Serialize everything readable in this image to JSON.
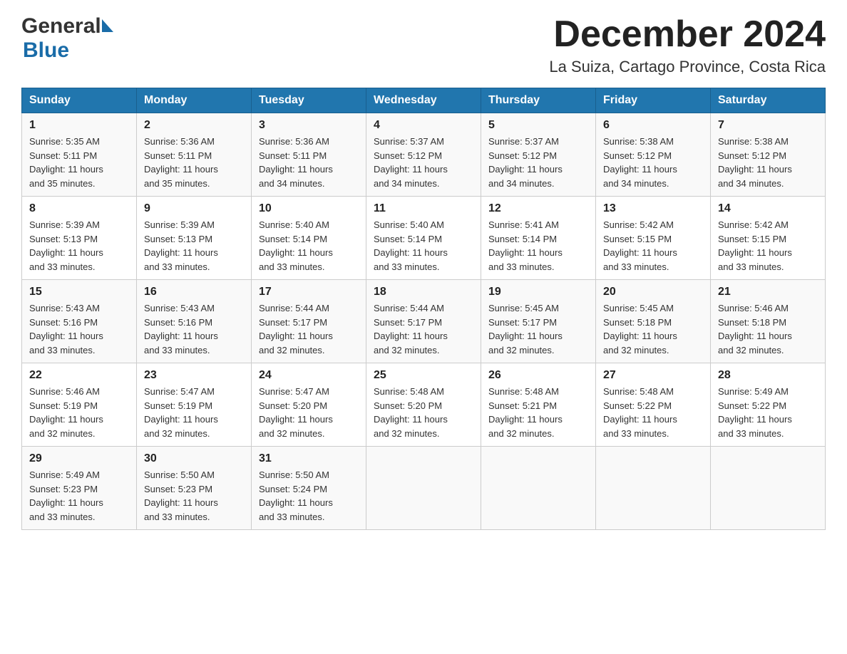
{
  "header": {
    "month_title": "December 2024",
    "location": "La Suiza, Cartago Province, Costa Rica"
  },
  "logo": {
    "general": "General",
    "blue": "Blue"
  },
  "days_of_week": [
    "Sunday",
    "Monday",
    "Tuesday",
    "Wednesday",
    "Thursday",
    "Friday",
    "Saturday"
  ],
  "weeks": [
    [
      {
        "day": "1",
        "sunrise": "5:35 AM",
        "sunset": "5:11 PM",
        "daylight": "11 hours and 35 minutes."
      },
      {
        "day": "2",
        "sunrise": "5:36 AM",
        "sunset": "5:11 PM",
        "daylight": "11 hours and 35 minutes."
      },
      {
        "day": "3",
        "sunrise": "5:36 AM",
        "sunset": "5:11 PM",
        "daylight": "11 hours and 34 minutes."
      },
      {
        "day": "4",
        "sunrise": "5:37 AM",
        "sunset": "5:12 PM",
        "daylight": "11 hours and 34 minutes."
      },
      {
        "day": "5",
        "sunrise": "5:37 AM",
        "sunset": "5:12 PM",
        "daylight": "11 hours and 34 minutes."
      },
      {
        "day": "6",
        "sunrise": "5:38 AM",
        "sunset": "5:12 PM",
        "daylight": "11 hours and 34 minutes."
      },
      {
        "day": "7",
        "sunrise": "5:38 AM",
        "sunset": "5:12 PM",
        "daylight": "11 hours and 34 minutes."
      }
    ],
    [
      {
        "day": "8",
        "sunrise": "5:39 AM",
        "sunset": "5:13 PM",
        "daylight": "11 hours and 33 minutes."
      },
      {
        "day": "9",
        "sunrise": "5:39 AM",
        "sunset": "5:13 PM",
        "daylight": "11 hours and 33 minutes."
      },
      {
        "day": "10",
        "sunrise": "5:40 AM",
        "sunset": "5:14 PM",
        "daylight": "11 hours and 33 minutes."
      },
      {
        "day": "11",
        "sunrise": "5:40 AM",
        "sunset": "5:14 PM",
        "daylight": "11 hours and 33 minutes."
      },
      {
        "day": "12",
        "sunrise": "5:41 AM",
        "sunset": "5:14 PM",
        "daylight": "11 hours and 33 minutes."
      },
      {
        "day": "13",
        "sunrise": "5:42 AM",
        "sunset": "5:15 PM",
        "daylight": "11 hours and 33 minutes."
      },
      {
        "day": "14",
        "sunrise": "5:42 AM",
        "sunset": "5:15 PM",
        "daylight": "11 hours and 33 minutes."
      }
    ],
    [
      {
        "day": "15",
        "sunrise": "5:43 AM",
        "sunset": "5:16 PM",
        "daylight": "11 hours and 33 minutes."
      },
      {
        "day": "16",
        "sunrise": "5:43 AM",
        "sunset": "5:16 PM",
        "daylight": "11 hours and 33 minutes."
      },
      {
        "day": "17",
        "sunrise": "5:44 AM",
        "sunset": "5:17 PM",
        "daylight": "11 hours and 32 minutes."
      },
      {
        "day": "18",
        "sunrise": "5:44 AM",
        "sunset": "5:17 PM",
        "daylight": "11 hours and 32 minutes."
      },
      {
        "day": "19",
        "sunrise": "5:45 AM",
        "sunset": "5:17 PM",
        "daylight": "11 hours and 32 minutes."
      },
      {
        "day": "20",
        "sunrise": "5:45 AM",
        "sunset": "5:18 PM",
        "daylight": "11 hours and 32 minutes."
      },
      {
        "day": "21",
        "sunrise": "5:46 AM",
        "sunset": "5:18 PM",
        "daylight": "11 hours and 32 minutes."
      }
    ],
    [
      {
        "day": "22",
        "sunrise": "5:46 AM",
        "sunset": "5:19 PM",
        "daylight": "11 hours and 32 minutes."
      },
      {
        "day": "23",
        "sunrise": "5:47 AM",
        "sunset": "5:19 PM",
        "daylight": "11 hours and 32 minutes."
      },
      {
        "day": "24",
        "sunrise": "5:47 AM",
        "sunset": "5:20 PM",
        "daylight": "11 hours and 32 minutes."
      },
      {
        "day": "25",
        "sunrise": "5:48 AM",
        "sunset": "5:20 PM",
        "daylight": "11 hours and 32 minutes."
      },
      {
        "day": "26",
        "sunrise": "5:48 AM",
        "sunset": "5:21 PM",
        "daylight": "11 hours and 32 minutes."
      },
      {
        "day": "27",
        "sunrise": "5:48 AM",
        "sunset": "5:22 PM",
        "daylight": "11 hours and 33 minutes."
      },
      {
        "day": "28",
        "sunrise": "5:49 AM",
        "sunset": "5:22 PM",
        "daylight": "11 hours and 33 minutes."
      }
    ],
    [
      {
        "day": "29",
        "sunrise": "5:49 AM",
        "sunset": "5:23 PM",
        "daylight": "11 hours and 33 minutes."
      },
      {
        "day": "30",
        "sunrise": "5:50 AM",
        "sunset": "5:23 PM",
        "daylight": "11 hours and 33 minutes."
      },
      {
        "day": "31",
        "sunrise": "5:50 AM",
        "sunset": "5:24 PM",
        "daylight": "11 hours and 33 minutes."
      },
      null,
      null,
      null,
      null
    ]
  ],
  "labels": {
    "sunrise": "Sunrise:",
    "sunset": "Sunset:",
    "daylight": "Daylight:"
  }
}
